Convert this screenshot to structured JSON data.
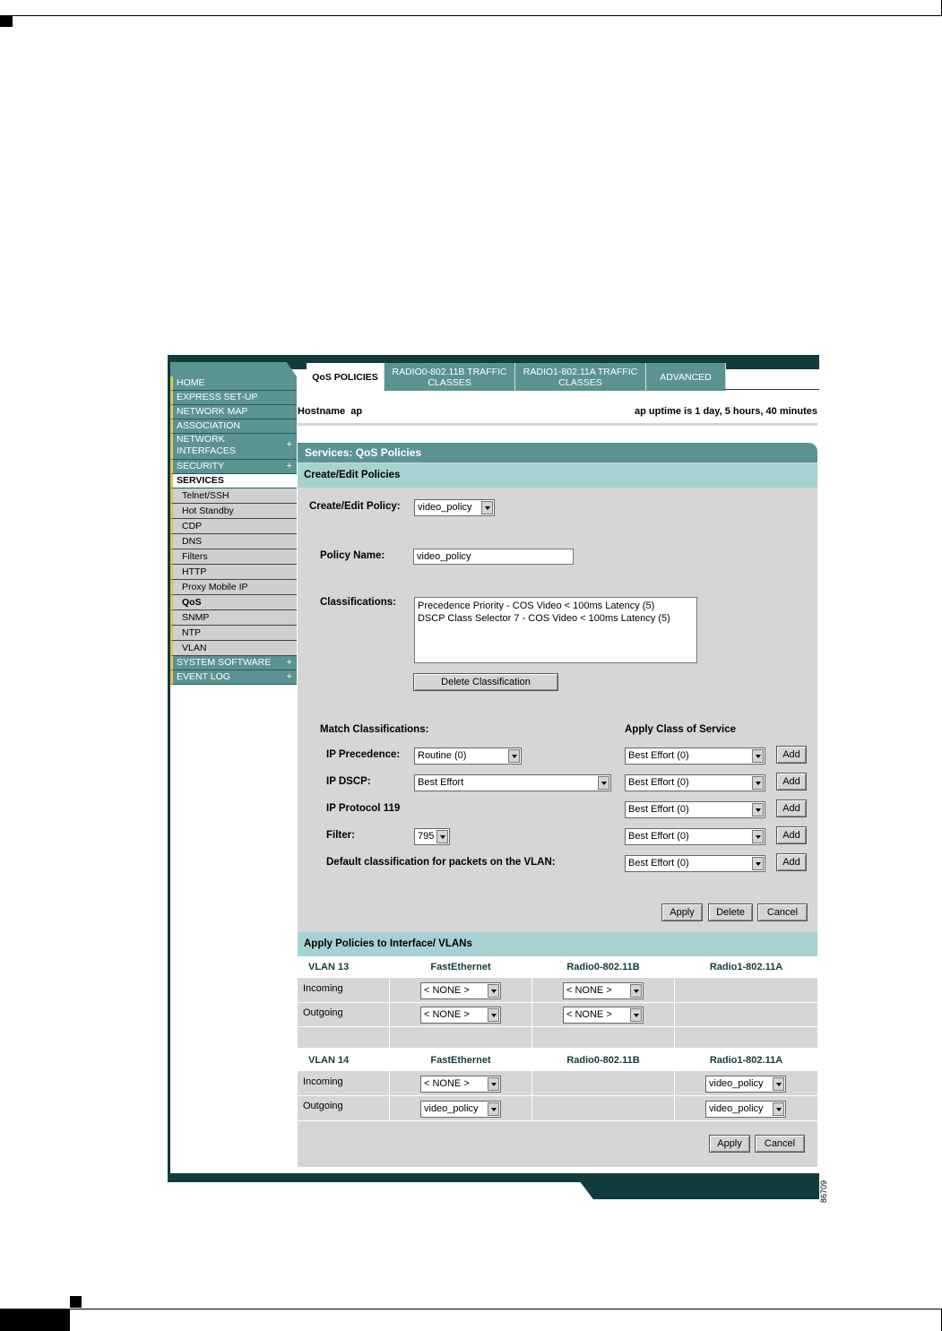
{
  "nav": {
    "items": [
      {
        "label": "HOME",
        "plus": ""
      },
      {
        "label": "EXPRESS SET-UP",
        "plus": ""
      },
      {
        "label": "NETWORK MAP",
        "plus": ""
      },
      {
        "label": "ASSOCIATION",
        "plus": ""
      },
      {
        "label": "NETWORK\nINTERFACES",
        "plus": "+"
      },
      {
        "label": "SECURITY",
        "plus": "+"
      },
      {
        "label": "SERVICES",
        "plus": ""
      }
    ],
    "sub_items": [
      "Telnet/SSH",
      "Hot Standby",
      "CDP",
      "DNS",
      "Filters",
      "HTTP",
      "Proxy Mobile IP",
      "QoS",
      "SNMP",
      "NTP",
      "VLAN"
    ],
    "bottom_items": [
      {
        "label": "SYSTEM SOFTWARE",
        "plus": "+"
      },
      {
        "label": "EVENT LOG",
        "plus": "+"
      }
    ]
  },
  "tabs": [
    {
      "label": "QoS POLICIES"
    },
    {
      "label": "RADIO0-802.11B TRAFFIC CLASSES"
    },
    {
      "label": "RADIO1-802.11A TRAFFIC CLASSES"
    },
    {
      "label": "ADVANCED"
    }
  ],
  "header": {
    "hostname": "Hostname  ap",
    "uptime": "ap uptime is 1 day, 5 hours, 40 minutes"
  },
  "panel": {
    "title": "Services: QoS Policies",
    "create_edit_section": "Create/Edit Policies",
    "create_edit_label": "Create/Edit Policy:",
    "create_edit_value": "video_policy",
    "policy_name_label": "Policy Name:",
    "policy_name_value": "video_policy",
    "classifications_label": "Classifications:",
    "classifications": [
      "Precedence Priority - COS Video < 100ms Latency (5)",
      "DSCP Class Selector 7 - COS Video < 100ms Latency (5)"
    ],
    "delete_classification": "Delete Classification",
    "match_label": "Match Classifications:",
    "apply_cos_label": "Apply Class of Service",
    "rows": [
      {
        "label": "IP Precedence:",
        "value": "Routine (0)",
        "cos": "Best Effort (0)",
        "add": "Add"
      },
      {
        "label": "IP DSCP:",
        "value": "Best Effort",
        "cos": "Best Effort (0)",
        "add": "Add"
      },
      {
        "label": "IP Protocol 119",
        "value": "",
        "cos": "Best Effort (0)",
        "add": "Add"
      },
      {
        "label": "Filter:",
        "value": "795",
        "cos": "Best Effort (0)",
        "add": "Add"
      },
      {
        "label": "Default classification for packets on the VLAN:",
        "value": "",
        "cos": "Best Effort (0)",
        "add": "Add"
      }
    ],
    "apply": "Apply",
    "delete": "Delete",
    "cancel": "Cancel"
  },
  "vlans": {
    "section": "Apply Policies to Interface/ VLANs",
    "columns": [
      "FastEthernet",
      "Radio0-802.11B",
      "Radio1-802.11A"
    ],
    "incoming": "Incoming",
    "outgoing": "Outgoing",
    "vlan13": {
      "name": "VLAN 13",
      "fe_in": "< NONE >",
      "fe_out": "< NONE >",
      "r0_in": "< NONE >",
      "r0_out": "< NONE >"
    },
    "vlan14": {
      "name": "VLAN 14",
      "fe_in": "< NONE >",
      "fe_out": "video_policy",
      "r1_in": "video_policy",
      "r1_out": "video_policy"
    },
    "apply": "Apply",
    "cancel": "Cancel"
  },
  "figure_id": "86709"
}
